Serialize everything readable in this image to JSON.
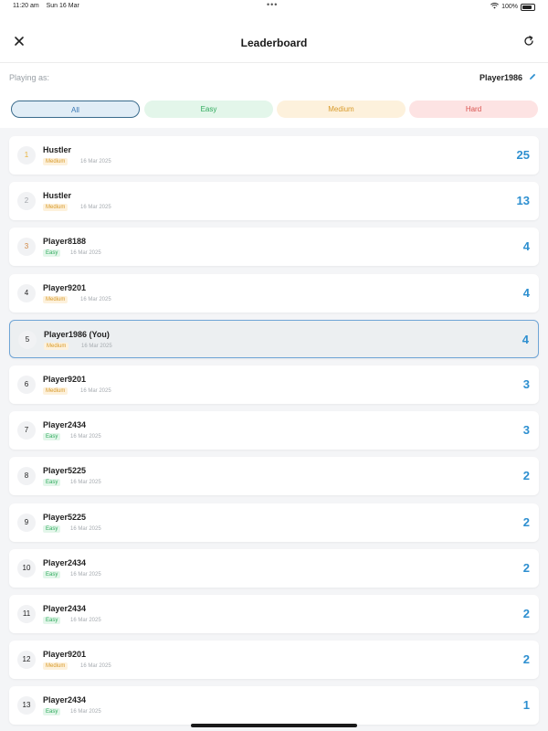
{
  "status_bar": {
    "time": "11:20 am",
    "date": "Sun 16 Mar",
    "battery": "100%"
  },
  "header": {
    "title": "Leaderboard"
  },
  "playing": {
    "label": "Playing as:",
    "name": "Player1986"
  },
  "filters": [
    {
      "label": "All",
      "selected": true
    },
    {
      "label": "Easy",
      "selected": false
    },
    {
      "label": "Medium",
      "selected": false
    },
    {
      "label": "Hard",
      "selected": false
    }
  ],
  "entries": [
    {
      "rank": "1",
      "name": "Hustler",
      "difficulty": "Medium",
      "date": "16 Mar 2025",
      "score": "25"
    },
    {
      "rank": "2",
      "name": "Hustler",
      "difficulty": "Medium",
      "date": "16 Mar 2025",
      "score": "13"
    },
    {
      "rank": "3",
      "name": "Player8188",
      "difficulty": "Easy",
      "date": "16 Mar 2025",
      "score": "4"
    },
    {
      "rank": "4",
      "name": "Player9201",
      "difficulty": "Medium",
      "date": "16 Mar 2025",
      "score": "4"
    },
    {
      "rank": "5",
      "name": "Player1986 (You)",
      "difficulty": "Medium",
      "date": "16 Mar 2025",
      "score": "4",
      "is_you": true
    },
    {
      "rank": "6",
      "name": "Player9201",
      "difficulty": "Medium",
      "date": "16 Mar 2025",
      "score": "3"
    },
    {
      "rank": "7",
      "name": "Player2434",
      "difficulty": "Easy",
      "date": "16 Mar 2025",
      "score": "3"
    },
    {
      "rank": "8",
      "name": "Player5225",
      "difficulty": "Easy",
      "date": "16 Mar 2025",
      "score": "2"
    },
    {
      "rank": "9",
      "name": "Player5225",
      "difficulty": "Easy",
      "date": "16 Mar 2025",
      "score": "2"
    },
    {
      "rank": "10",
      "name": "Player2434",
      "difficulty": "Easy",
      "date": "16 Mar 2025",
      "score": "2"
    },
    {
      "rank": "11",
      "name": "Player2434",
      "difficulty": "Easy",
      "date": "16 Mar 2025",
      "score": "2"
    },
    {
      "rank": "12",
      "name": "Player9201",
      "difficulty": "Medium",
      "date": "16 Mar 2025",
      "score": "2"
    },
    {
      "rank": "13",
      "name": "Player2434",
      "difficulty": "Easy",
      "date": "16 Mar 2025",
      "score": "1"
    }
  ],
  "colors": {
    "accent": "#2d8fd0",
    "easy": "#2faa5c",
    "medium": "#d89a2a",
    "hard": "#d9534f"
  },
  "icons": {
    "close": "close-icon",
    "refresh": "refresh-icon",
    "edit": "pencil-icon"
  }
}
